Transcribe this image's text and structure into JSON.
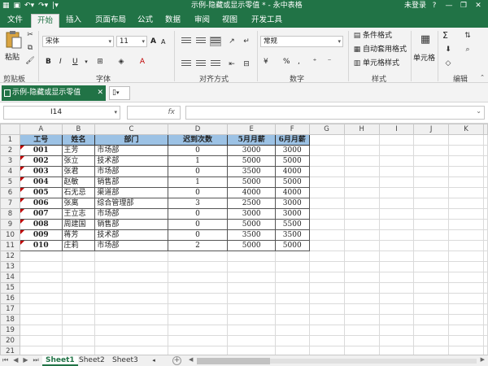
{
  "titlebar": {
    "title": "示例-隐藏或显示零值 * - 永中表格",
    "login": "未登录",
    "qat_icons": [
      "app-logo-icon",
      "save-icon",
      "undo-icon",
      "redo-icon",
      "customize-icon"
    ],
    "win_buttons": [
      "ribbon-display-icon",
      "minimize-icon",
      "restore-icon",
      "close-icon"
    ]
  },
  "tabs": [
    {
      "label": "文件",
      "active": false
    },
    {
      "label": "开始",
      "active": true
    },
    {
      "label": "插入",
      "active": false
    },
    {
      "label": "页面布局",
      "active": false
    },
    {
      "label": "公式",
      "active": false
    },
    {
      "label": "数据",
      "active": false
    },
    {
      "label": "审阅",
      "active": false
    },
    {
      "label": "视图",
      "active": false
    },
    {
      "label": "开发工具",
      "active": false
    }
  ],
  "ribbon": {
    "clipboard": {
      "paste_label": "粘贴",
      "group_label": "剪贴板"
    },
    "font": {
      "font_name": "宋体",
      "font_size": "11",
      "bold": "B",
      "italic": "I",
      "underline": "U",
      "grow": "A",
      "shrink": "A",
      "group_label": "字体"
    },
    "alignment": {
      "group_label": "对齐方式"
    },
    "number": {
      "format": "常规",
      "currency": "¥",
      "percent": "%",
      "comma": ",",
      "group_label": "数字"
    },
    "styles": {
      "conditional": "条件格式",
      "table_format": "自动套用格式",
      "cell_style": "单元格样式",
      "group_label": "样式"
    },
    "cells": {
      "cell_label": "单元格"
    },
    "editing": {
      "sum": "Σ",
      "group_label": "编辑"
    }
  },
  "workbook_tab": {
    "name": "示例-隐藏或显示零值"
  },
  "formula_bar": {
    "name_box": "I14",
    "fx": "fx",
    "formula": ""
  },
  "grid": {
    "columns": [
      "A",
      "B",
      "C",
      "D",
      "E",
      "F",
      "G",
      "H",
      "I",
      "J",
      "K"
    ],
    "rows": [
      "1",
      "2",
      "3",
      "4",
      "5",
      "6",
      "7",
      "8",
      "9",
      "10",
      "11",
      "12",
      "13",
      "14",
      "15",
      "16",
      "17",
      "18",
      "19",
      "20",
      "21"
    ],
    "headers": [
      "工号",
      "姓名",
      "部门",
      "迟到次数",
      "5月月薪",
      "6月月薪"
    ],
    "data": [
      [
        "001",
        "王芳",
        "市场部",
        "0",
        "3000",
        "3000"
      ],
      [
        "002",
        "张立",
        "技术部",
        "1",
        "5000",
        "5000"
      ],
      [
        "003",
        "张君",
        "市场部",
        "0",
        "3500",
        "4000"
      ],
      [
        "004",
        "赵敏",
        "销售部",
        "1",
        "5000",
        "5000"
      ],
      [
        "005",
        "石无忌",
        "渠道部",
        "0",
        "4000",
        "4000"
      ],
      [
        "006",
        "张离",
        "综合管理部",
        "3",
        "2500",
        "3000"
      ],
      [
        "007",
        "王立志",
        "市场部",
        "0",
        "3000",
        "3000"
      ],
      [
        "008",
        "周建国",
        "销售部",
        "0",
        "5000",
        "5500"
      ],
      [
        "009",
        "蒋芳",
        "技术部",
        "0",
        "3500",
        "3500"
      ],
      [
        "010",
        "庄莉",
        "市场部",
        "2",
        "5000",
        "5000"
      ]
    ]
  },
  "sheets": [
    {
      "label": "Sheet1",
      "active": true
    },
    {
      "label": "Sheet2",
      "active": false
    },
    {
      "label": "Sheet3",
      "active": false
    }
  ],
  "colors": {
    "accent": "#217346",
    "header_fill": "#9cc2e5",
    "comment_marker": "#c00000"
  }
}
